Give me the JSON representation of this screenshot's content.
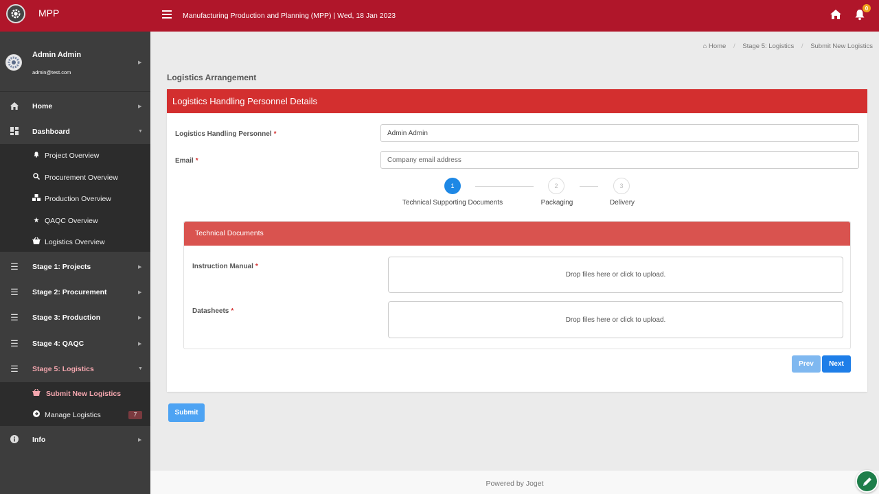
{
  "topbar": {
    "brand": "MPP",
    "title": "Manufacturing Production and Planning (MPP)  |  Wed, 18 Jan 2023",
    "notifications": "0",
    "color": "#b0162a"
  },
  "user": {
    "name": "Admin Admin",
    "email": "admin@test.com"
  },
  "sidebar": {
    "items": [
      {
        "label": "Home",
        "icon": "home-icon"
      },
      {
        "label": "Dashboard",
        "icon": "dashboard-icon"
      },
      {
        "label": "Stage 1: Projects",
        "icon": "list-icon"
      },
      {
        "label": "Stage 2: Procurement",
        "icon": "list-icon"
      },
      {
        "label": "Stage 3: Production",
        "icon": "list-icon"
      },
      {
        "label": "Stage 4: QAQC",
        "icon": "list-icon"
      },
      {
        "label": "Stage 5: Logistics",
        "icon": "list-icon"
      },
      {
        "label": "Info",
        "icon": "info-icon"
      }
    ],
    "dashboard_sub": [
      {
        "label": "Project Overview",
        "icon": "bell-icon"
      },
      {
        "label": "Procurement Overview",
        "icon": "search-icon"
      },
      {
        "label": "Production Overview",
        "icon": "cubes-icon"
      },
      {
        "label": "QAQC Overview",
        "icon": "star-icon"
      },
      {
        "label": "Logistics Overview",
        "icon": "basket-icon"
      }
    ],
    "logistics_sub": [
      {
        "label": "Submit New Logistics",
        "icon": "basket-icon"
      },
      {
        "label": "Manage Logistics",
        "icon": "arrow-circle-icon",
        "badge": "7"
      }
    ]
  },
  "breadcrumb": [
    "Home",
    "Stage 5: Logistics",
    "Submit New Logistics"
  ],
  "page": {
    "heading": "Logistics Arrangement",
    "card_title": "Logistics Handling Personnel Details",
    "fields": {
      "personnel_label": "Logistics Handling Personnel",
      "personnel_value": "Admin Admin",
      "email_label": "Email",
      "email_placeholder": "Company email address",
      "required_mark": "*"
    },
    "steps": [
      {
        "num": "1",
        "label": "Technical Supporting Documents",
        "active": true
      },
      {
        "num": "2",
        "label": "Packaging",
        "active": false
      },
      {
        "num": "3",
        "label": "Delivery",
        "active": false
      }
    ],
    "panel": {
      "title": "Technical Documents",
      "instruction_label": "Instruction Manual",
      "datasheets_label": "Datasheets",
      "dropzone_text": "Drop files here or click to upload."
    },
    "buttons": {
      "prev": "Prev",
      "next": "Next",
      "submit": "Submit"
    }
  },
  "footer": "Powered by Joget"
}
